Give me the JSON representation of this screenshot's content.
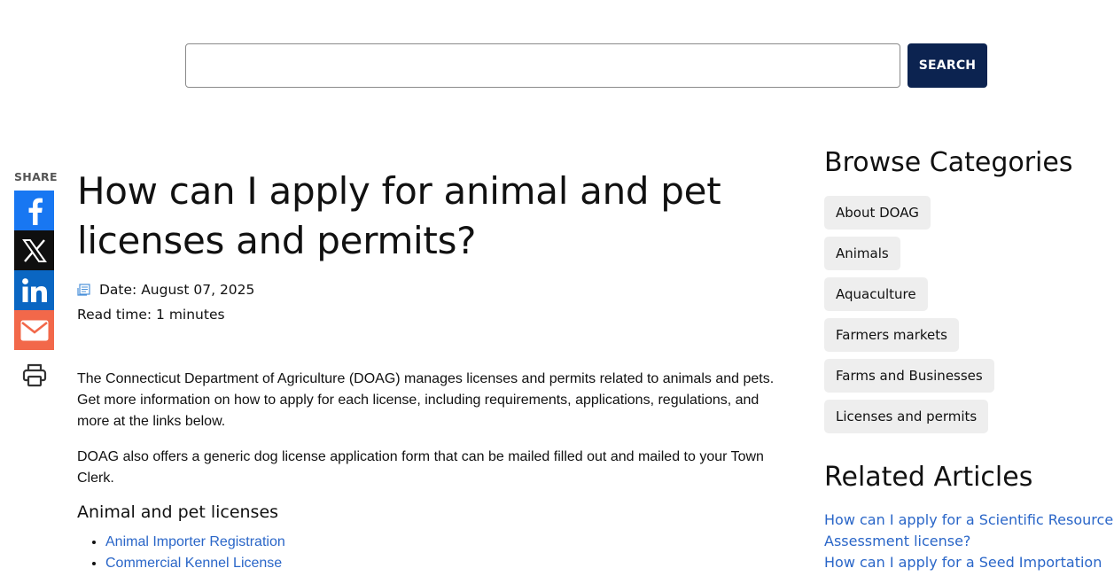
{
  "search": {
    "value": "",
    "placeholder": "",
    "button_label": "SEARCH"
  },
  "share": {
    "label": "SHARE",
    "buttons": [
      {
        "icon": "facebook-icon",
        "color": "#1877f2"
      },
      {
        "icon": "x-icon",
        "color": "#0f0f0f"
      },
      {
        "icon": "linkedin-icon",
        "color": "#0a66c2"
      },
      {
        "icon": "email-icon",
        "color": "#f2684a"
      },
      {
        "icon": "printer-icon",
        "color": "#333333"
      }
    ]
  },
  "article": {
    "title": "How can I apply for animal and pet licenses and permits?",
    "date": "Date: August 07, 2025",
    "read_time": "Read time: 1 minutes",
    "paragraphs": [
      "The Connecticut Department of Agriculture (DOAG) manages licenses and permits related to animals and pets. Get more information on how to apply for each license, including requirements, applications, regulations, and more at the links below.",
      "DOAG also offers a generic dog license application form that can be mailed filled out and mailed to your Town Clerk."
    ],
    "section_heading": "Animal and pet licenses",
    "links": [
      "Animal Importer Registration",
      "Commercial Kennel License"
    ]
  },
  "sidebar": {
    "browse_heading": "Browse Categories",
    "categories": [
      "About DOAG",
      "Animals",
      "Aquaculture",
      "Farmers markets",
      "Farms and Businesses",
      "Licenses and permits"
    ],
    "related_heading": "Related Articles",
    "related": [
      "How can I apply for a Scientific Resource Assessment license?",
      "How can I apply for a Seed Importation"
    ]
  },
  "colors": {
    "search_button": "#0c2350",
    "link": "#2a66c8",
    "chip_bg": "#eeeeee"
  }
}
